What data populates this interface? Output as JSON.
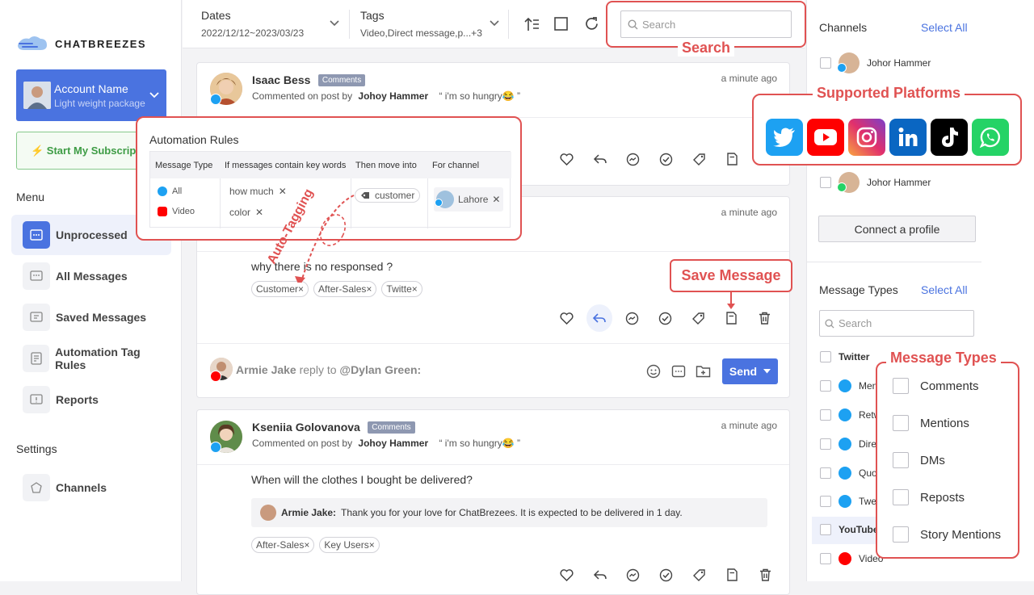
{
  "brand": {
    "name": "CHATBREEZES"
  },
  "account": {
    "name": "Account Name",
    "package": "Light weight package"
  },
  "subscription_label": "⚡ Start My Subscription",
  "menu": {
    "title": "Menu",
    "items": [
      {
        "label": "Unprocessed"
      },
      {
        "label": "All Messages"
      },
      {
        "label": "Saved Messages"
      },
      {
        "label": "Automation Tag Rules"
      },
      {
        "label": "Reports"
      }
    ]
  },
  "settings": {
    "title": "Settings",
    "items": [
      {
        "label": "Channels"
      }
    ]
  },
  "filters": {
    "dates_label": "Dates",
    "dates_value": "2022/12/12~2023/03/23",
    "tags_label": "Tags",
    "tags_value": "Video,Direct message,p...+3"
  },
  "search": {
    "placeholder": "Search"
  },
  "feed": {
    "post1": {
      "user": "Isaac Bess",
      "badge": "Comments",
      "sub_prefix": "Commented on post by",
      "sub_author": "Johoy Hammer",
      "sub_quote": "“ i'm so hungry😂 ”",
      "time": "a minute ago"
    },
    "post2": {
      "time": "a minute ago",
      "message": "why there is no responsed ?",
      "tags": [
        "Customer",
        "After-Sales",
        "Twitte"
      ]
    },
    "reply": {
      "user": "Armie Jake",
      "text": "reply to",
      "target": "@Dylan Green:",
      "send": "Send"
    },
    "post3": {
      "user": "Kseniia Golovanova",
      "badge": "Comments",
      "sub_prefix": "Commented on post by",
      "sub_author": "Johoy Hammer",
      "sub_quote": "“ i'm so hungry😂 ”",
      "time": "a minute ago",
      "message": "When will the clothes I bought be delivered?",
      "reply_user": "Armie Jake:",
      "reply_text": "Thank you for your love for ChatBrezees. It is expected to be delivered in 1 day.",
      "tags": [
        "After-Sales",
        "Key Users"
      ]
    }
  },
  "channels": {
    "title": "Channels",
    "select_all": "Select All",
    "profiles": [
      {
        "name": "Johor Hammer"
      },
      {
        "name": "Johor Hammer"
      }
    ],
    "connect": "Connect a profile"
  },
  "message_types": {
    "title": "Message Types",
    "select_all": "Select All",
    "search_placeholder": "Search",
    "twitter_group": "Twitter",
    "twitter_items": [
      "Men",
      "Retw",
      "Direc",
      "Quot",
      "Twee"
    ],
    "youtube_group": "YouTube",
    "youtube_items": [
      "Video"
    ]
  },
  "callouts": {
    "search": "Search",
    "platforms": "Supported Platforms",
    "save_message": "Save Message",
    "message_types": "Message Types",
    "auto_tagging": "Auto-Tagging"
  },
  "automation_rules": {
    "title": "Automation Rules",
    "headers": [
      "Message Type",
      "If messages contain key words",
      "Then move into",
      "For channel"
    ],
    "types": [
      "All",
      "Video"
    ],
    "keywords": [
      "how much",
      "color"
    ],
    "move_into": "customer",
    "channel": "Lahore"
  },
  "message_types_popup": [
    "Comments",
    "Mentions",
    "DMs",
    "Reposts",
    "Story Mentions"
  ],
  "platforms": [
    "twitter",
    "youtube",
    "instagram",
    "linkedin",
    "tiktok",
    "whatsapp"
  ],
  "colors": {
    "accent": "#4a73e0",
    "callout": "#e05252",
    "twitter": "#1da1f2",
    "youtube": "#ff0000"
  }
}
